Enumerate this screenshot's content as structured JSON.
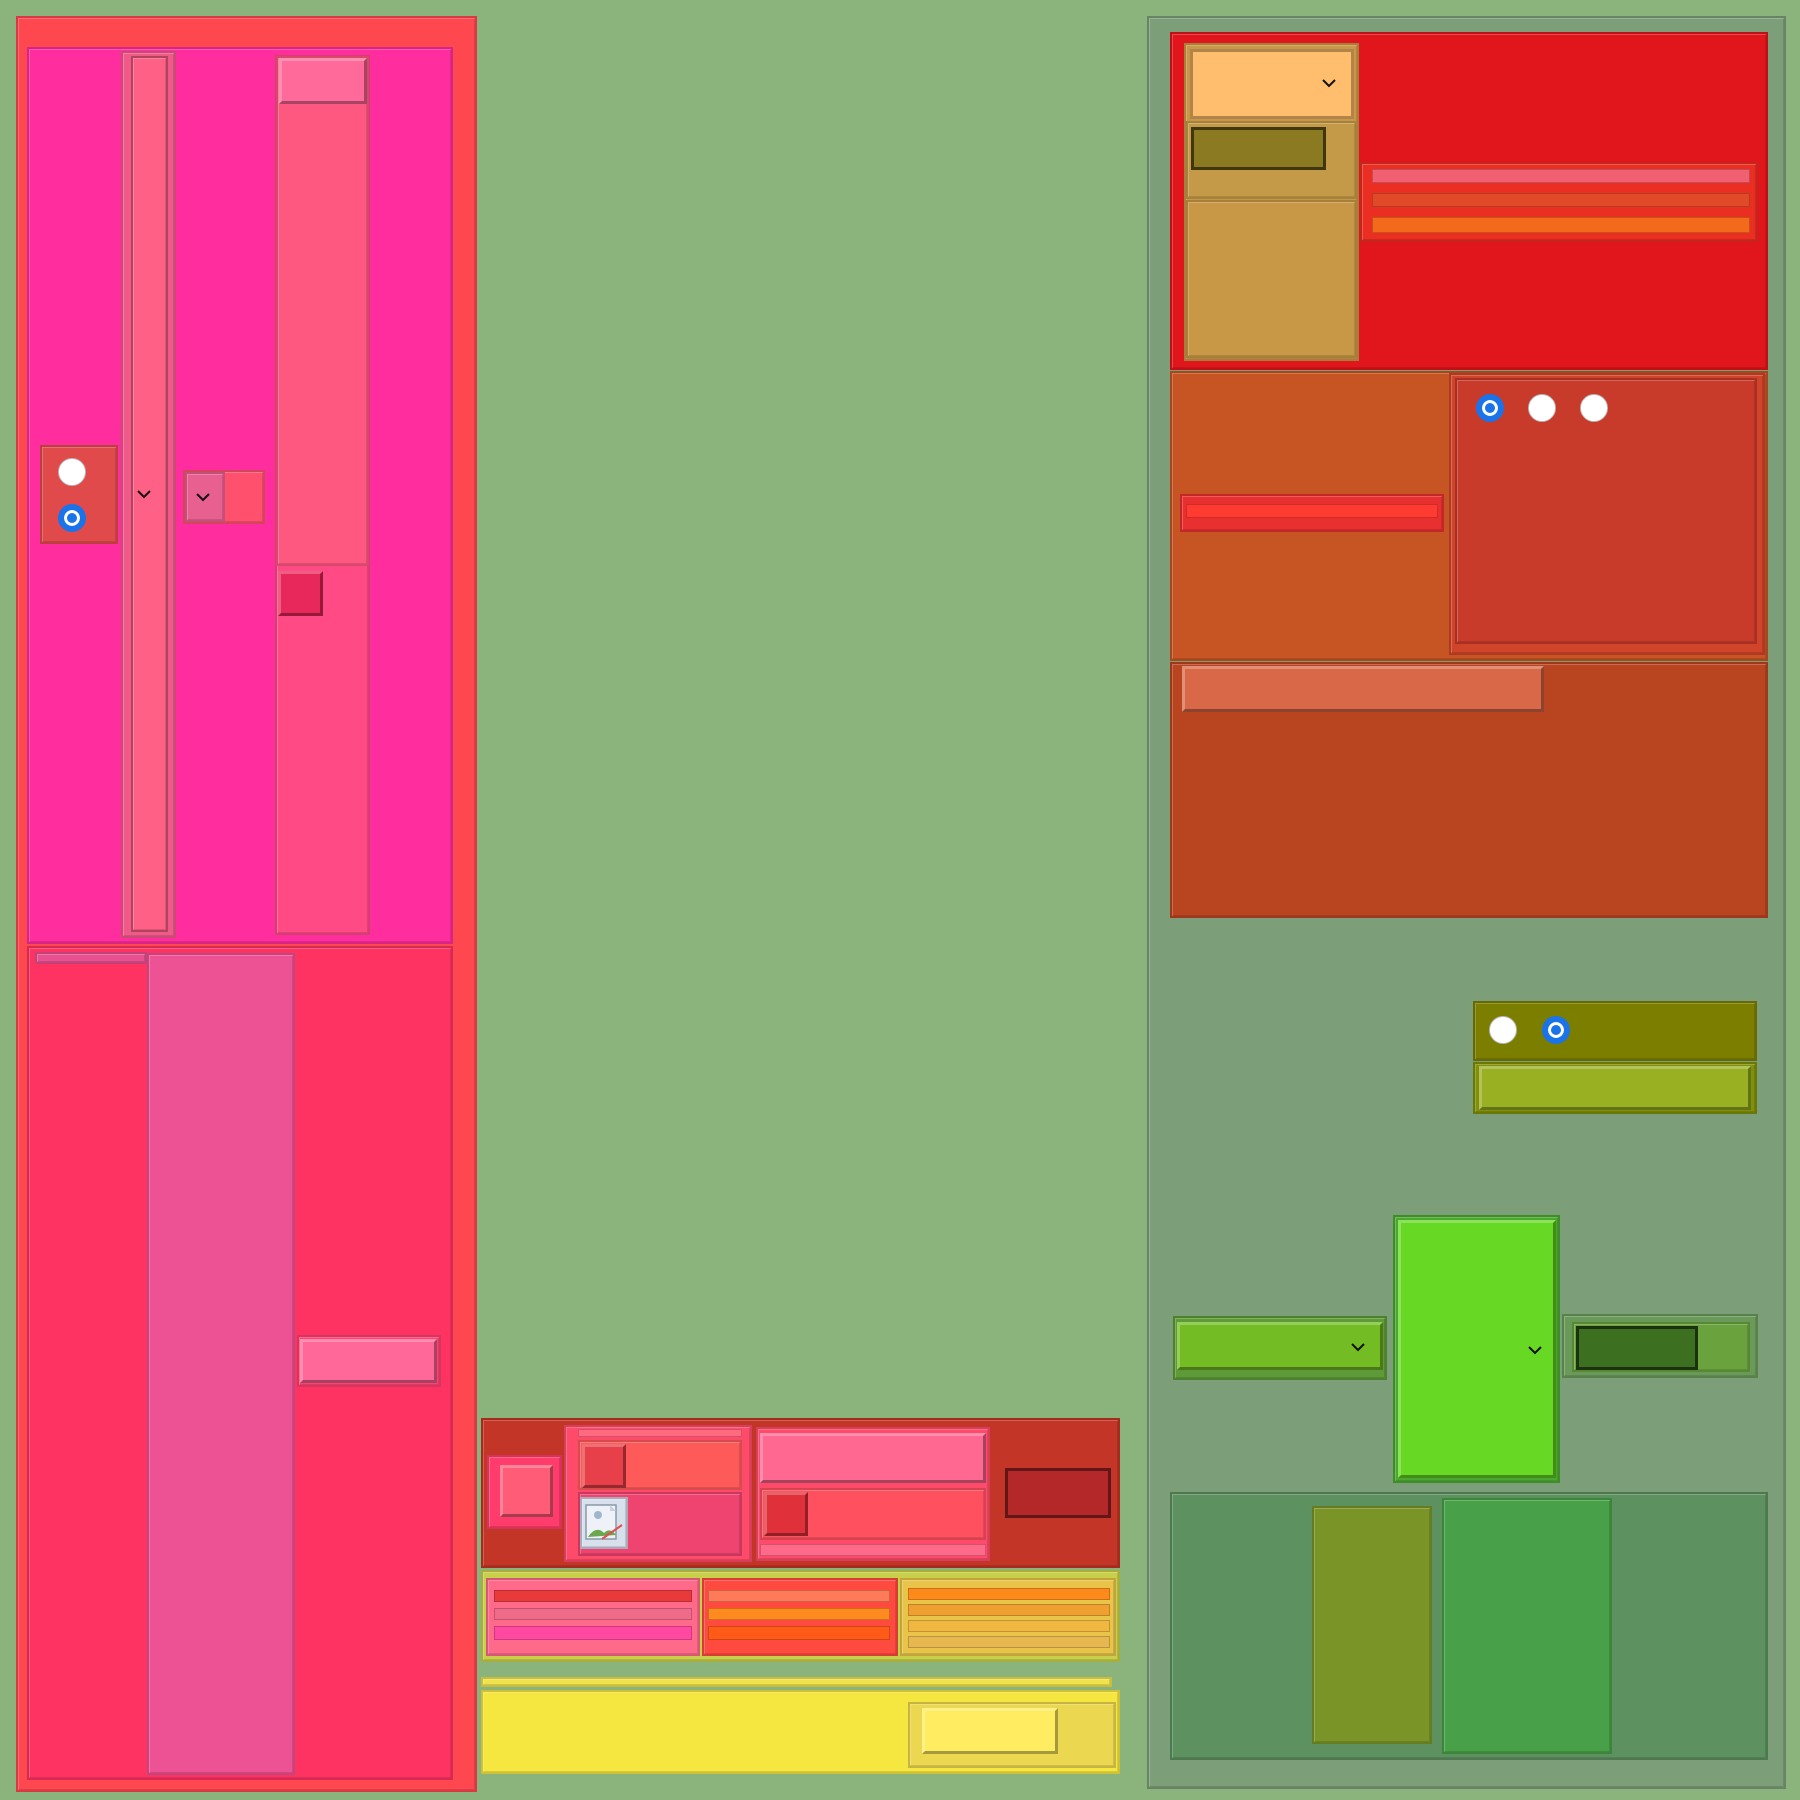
{
  "colors": {
    "background": "#8ab47c",
    "left_frame": "#ff4750",
    "pink_panel": "#ff2d9e",
    "rose_panel": "#ff3362",
    "red_panel": "#e1161c",
    "orange_panel": "#c65523",
    "rust_panel": "#b94420",
    "olive_bar": "#7c7e00",
    "lime_panel": "#67d824",
    "green_panel": "#5e9160",
    "yellow_panel": "#f6e640",
    "radio_selected": "#1a73e8"
  },
  "left_panel": {
    "radio_group": {
      "options": [
        {
          "selected": false
        },
        {
          "selected": true
        }
      ]
    },
    "dropdowns": [
      {
        "icon": "chevron-down-icon"
      },
      {
        "icon": "chevron-down-icon"
      }
    ]
  },
  "top_right_panel": {
    "dropdown": {
      "icon": "chevron-down-icon"
    },
    "radio_group": {
      "options": [
        {
          "selected": true
        },
        {
          "selected": false
        },
        {
          "selected": false
        }
      ]
    }
  },
  "mid_right_panel": {
    "radio_group": {
      "options": [
        {
          "selected": false
        },
        {
          "selected": true
        }
      ]
    }
  },
  "bottom_right_panel": {
    "dropdowns": [
      {
        "icon": "chevron-down-icon"
      },
      {
        "icon": "chevron-down-icon"
      }
    ]
  },
  "bottom_center_panel": {
    "image_placeholder": {
      "icon": "broken-image-icon"
    }
  }
}
